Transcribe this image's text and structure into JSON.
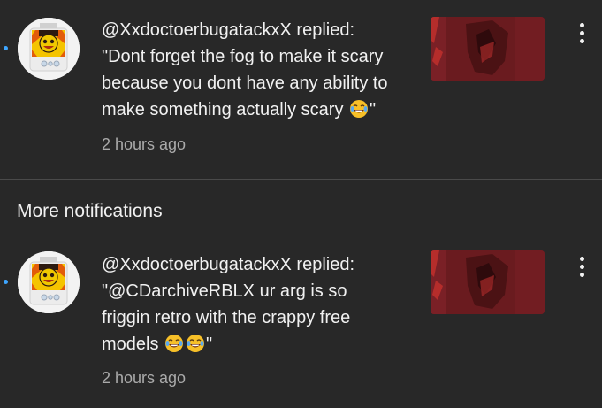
{
  "notifications": [
    {
      "message_lines": [
        "@XxdoctoerbugatackxX replied:",
        "\"Dont forget the fog to make it scary",
        "because you dont have any ability to",
        "make something actually scary"
      ],
      "closing_quote": "\"",
      "emoji_count": 1,
      "timestamp": "2 hours ago",
      "unread": true,
      "emoji": "face-with-tears-of-joy"
    },
    {
      "message_lines": [
        "@XxdoctoerbugatackxX replied:",
        "\"@CDarchiveRBLX ur arg is so",
        "friggin retro with the crappy free",
        "models"
      ],
      "closing_quote": "\"",
      "emoji_count": 2,
      "timestamp": "2 hours ago",
      "unread": true,
      "emoji": "face-with-tears-of-joy"
    }
  ],
  "sections": {
    "more_notifications": "More notifications"
  },
  "colors": {
    "background": "#282828",
    "text": "#f1f1f1",
    "secondary_text": "#aaaaaa",
    "unread_dot": "#3ea6ff",
    "divider": "#4a4a4a",
    "thumbnail": "#6e1c20"
  },
  "icons": {
    "menu": "more-vert-icon",
    "emoji": "face-with-tears-of-joy-icon"
  }
}
